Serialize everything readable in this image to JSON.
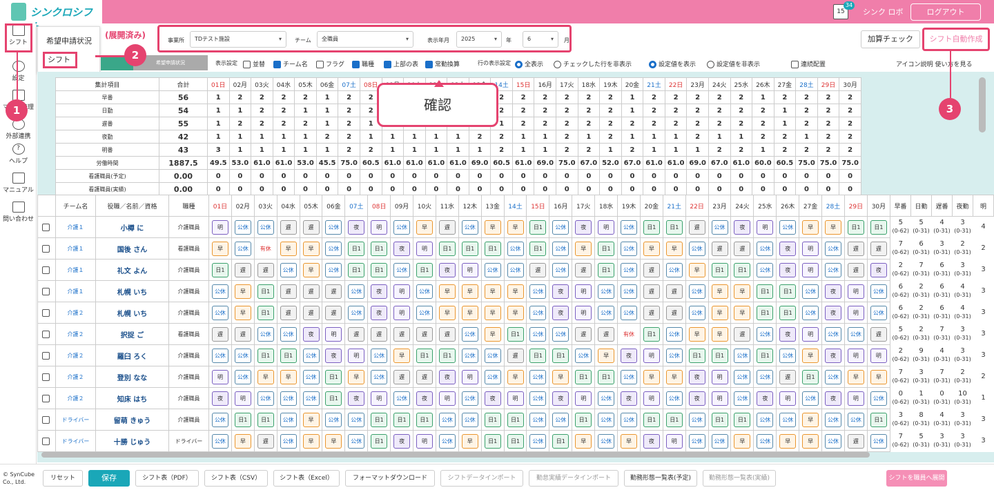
{
  "app": {
    "name": "シンクロシフト",
    "cal_day": "15",
    "notif": "34",
    "user": "シンク ロボ",
    "logout": "ログアウト"
  },
  "sidebar": [
    {
      "label": "シフト"
    },
    {
      "label": "設定"
    },
    {
      "label": "マスタ管理"
    },
    {
      "label": "外部連携"
    },
    {
      "label": "ヘルプ"
    },
    {
      "label": "マニュアル"
    },
    {
      "label": "問い合わせ"
    }
  ],
  "dropdown": {
    "item1": "希望申請状況",
    "item2": "シフト",
    "note": "(展開済み)"
  },
  "filters": {
    "office_label": "事業所",
    "office": "TDテスト施設",
    "team_label": "チーム",
    "team": "全職員",
    "ym_label": "表示年月",
    "year": "2025",
    "year_unit": "年",
    "month": "6",
    "month_unit": "月"
  },
  "buttons": {
    "calc": "加算チェック",
    "auto": "シフト自動作成"
  },
  "tabs": {
    "tab2": "希望申請状況"
  },
  "options": {
    "display": "表示設定",
    "sort": "並替",
    "team_name": "チーム名",
    "flag": "フラグ",
    "job": "職種",
    "top_table": "上部の表",
    "fte": "常勤換算",
    "row_setting": "行の表示設定",
    "all": "全表示",
    "hide_checked": "チェックした行を非表示",
    "show_value": "設定値を表示",
    "hide_value": "設定値を非表示",
    "serial": "連続配置",
    "icon_help": "アイコン説明",
    "howto": "使い方を見る"
  },
  "callout": "確認",
  "marks": [
    "1",
    "2",
    "3"
  ],
  "days": [
    "01日",
    "02月",
    "03火",
    "04水",
    "05木",
    "06金",
    "07土",
    "08日",
    "09月",
    "10火",
    "11水",
    "12木",
    "13金",
    "14土",
    "15日",
    "16月",
    "17火",
    "18水",
    "19木",
    "20金",
    "21土",
    "22日",
    "23月",
    "24火",
    "25水",
    "26木",
    "27金",
    "28土",
    "29日",
    "30月"
  ],
  "summary": {
    "header": "集計項目",
    "total": "合計",
    "rows": [
      {
        "label": "早番",
        "total": "56",
        "vals": [
          "1",
          "2",
          "2",
          "2",
          "2",
          "1",
          "2",
          "2",
          "",
          "",
          "",
          "",
          "",
          "2",
          "2",
          "2",
          "2",
          "2",
          "2",
          "1",
          "2",
          "2",
          "2",
          "2",
          "2",
          "1",
          "2",
          "2",
          "2",
          "2"
        ]
      },
      {
        "label": "日勤",
        "total": "54",
        "vals": [
          "1",
          "1",
          "2",
          "2",
          "1",
          "1",
          "2",
          "2",
          "",
          "",
          "",
          "",
          "",
          "2",
          "2",
          "2",
          "2",
          "2",
          "2",
          "1",
          "2",
          "2",
          "2",
          "2",
          "2",
          "2",
          "1",
          "2",
          "2",
          "2"
        ]
      },
      {
        "label": "遅番",
        "total": "55",
        "vals": [
          "1",
          "2",
          "2",
          "2",
          "2",
          "1",
          "2",
          "1",
          "",
          "",
          "",
          "",
          "",
          "1",
          "2",
          "2",
          "2",
          "2",
          "2",
          "2",
          "2",
          "2",
          "2",
          "2",
          "2",
          "2",
          "1",
          "2",
          "2",
          "2"
        ]
      },
      {
        "label": "夜勤",
        "total": "42",
        "vals": [
          "1",
          "1",
          "1",
          "1",
          "1",
          "2",
          "2",
          "1",
          "1",
          "1",
          "1",
          "1",
          "2",
          "2",
          "1",
          "1",
          "2",
          "1",
          "2",
          "1",
          "1",
          "1",
          "2",
          "1",
          "1",
          "2",
          "2",
          "1",
          "2",
          "2"
        ]
      },
      {
        "label": "明番",
        "total": "43",
        "vals": [
          "3",
          "1",
          "1",
          "1",
          "1",
          "1",
          "2",
          "2",
          "1",
          "1",
          "1",
          "1",
          "1",
          "2",
          "1",
          "1",
          "2",
          "2",
          "1",
          "2",
          "1",
          "1",
          "1",
          "2",
          "2",
          "1",
          "2",
          "2",
          "2",
          "2"
        ]
      },
      {
        "label": "労働時間",
        "total": "1887.5",
        "vals": [
          "49.5",
          "53.0",
          "61.0",
          "61.0",
          "53.0",
          "45.5",
          "75.0",
          "60.5",
          "61.0",
          "61.0",
          "61.0",
          "61.0",
          "69.0",
          "60.5",
          "61.0",
          "69.0",
          "75.0",
          "67.0",
          "52.0",
          "67.0",
          "61.0",
          "61.0",
          "69.0",
          "67.0",
          "61.0",
          "60.0",
          "60.5",
          "75.0",
          "75.0",
          "75.0"
        ]
      },
      {
        "label": "看護職員(予定)",
        "total": "0.00",
        "vals": [
          "0",
          "0",
          "0",
          "0",
          "0",
          "0",
          "0",
          "0",
          "0",
          "0",
          "0",
          "0",
          "0",
          "0",
          "0",
          "0",
          "0",
          "0",
          "0",
          "0",
          "0",
          "0",
          "0",
          "0",
          "0",
          "0",
          "0",
          "0",
          "0",
          "0"
        ]
      },
      {
        "label": "看護職員(実績)",
        "total": "0.00",
        "vals": [
          "0",
          "0",
          "0",
          "0",
          "0",
          "0",
          "0",
          "0",
          "0",
          "0",
          "0",
          "0",
          "0",
          "0",
          "0",
          "0",
          "0",
          "0",
          "0",
          "0",
          "0",
          "0",
          "0",
          "0",
          "0",
          "0",
          "0",
          "0",
          "0",
          "0"
        ]
      }
    ]
  },
  "staff": {
    "team_h": "チーム名",
    "role_h": "役職／名前／資格",
    "job_h": "職種",
    "cols": [
      "早番",
      "日勤",
      "遅番",
      "夜勤",
      "明"
    ],
    "rows": [
      {
        "team": "介護１",
        "name": "小樽 に",
        "job": "介護職員",
        "shifts": [
          "明",
          "公休",
          "公休",
          "遅",
          "遅",
          "公休",
          "夜",
          "明",
          "公休",
          "早",
          "遅",
          "公休",
          "早",
          "早",
          "日1",
          "公休",
          "夜",
          "明",
          "公休",
          "日1",
          "日1",
          "遅",
          "公休",
          "夜",
          "明",
          "公休",
          "早",
          "早",
          "日1",
          "日1"
        ],
        "stats": [
          [
            "5",
            "(0-62)"
          ],
          [
            "5",
            "(0-31)"
          ],
          [
            "4",
            "(0-31)"
          ],
          [
            "3",
            "(0-31)"
          ],
          [
            "4",
            ""
          ]
        ]
      },
      {
        "team": "介護１",
        "name": "国後 さん",
        "job": "看護職員",
        "shifts": [
          "早",
          "公休",
          "有休",
          "早",
          "早",
          "公休",
          "日1",
          "日1",
          "夜",
          "明",
          "日1",
          "日1",
          "日1",
          "公休",
          "日1",
          "公休",
          "早",
          "日1",
          "公休",
          "早",
          "早",
          "公休",
          "遅",
          "遅",
          "公休",
          "夜",
          "明",
          "公休",
          "遅",
          "遅"
        ],
        "stats": [
          [
            "7",
            "(0-62)"
          ],
          [
            "6",
            "(0-31)"
          ],
          [
            "3",
            "(0-31)"
          ],
          [
            "2",
            "(0-31)"
          ],
          [
            "2",
            ""
          ]
        ]
      },
      {
        "team": "介護１",
        "name": "礼文 よん",
        "job": "介護職員",
        "shifts": [
          "日1",
          "遅",
          "遅",
          "公休",
          "早",
          "公休",
          "日1",
          "日1",
          "公休",
          "日1",
          "夜",
          "明",
          "公休",
          "公休",
          "遅",
          "公休",
          "遅",
          "日1",
          "公休",
          "遅",
          "公休",
          "早",
          "日1",
          "日1",
          "公休",
          "夜",
          "明",
          "公休",
          "遅",
          "夜"
        ],
        "stats": [
          [
            "2",
            "(0-62)"
          ],
          [
            "7",
            "(0-31)"
          ],
          [
            "6",
            "(0-31)"
          ],
          [
            "3",
            "(0-31)"
          ],
          [
            "3",
            ""
          ]
        ]
      },
      {
        "team": "介護１",
        "name": "札幌 いち",
        "job": "介護職員",
        "shifts": [
          "公休",
          "早",
          "日1",
          "遅",
          "遅",
          "遅",
          "公休",
          "夜",
          "明",
          "公休",
          "早",
          "早",
          "早",
          "早",
          "公休",
          "夜",
          "明",
          "公休",
          "公休",
          "遅",
          "遅",
          "公休",
          "早",
          "早",
          "日1",
          "日1",
          "公休",
          "夜",
          "明",
          "公休"
        ],
        "stats": [
          [
            "6",
            "(0-62)"
          ],
          [
            "2",
            "(0-31)"
          ],
          [
            "6",
            "(0-31)"
          ],
          [
            "4",
            "(0-31)"
          ],
          [
            "3",
            ""
          ]
        ]
      },
      {
        "team": "介護２",
        "name": "札幌 いち",
        "job": "介護職員",
        "shifts": [
          "公休",
          "早",
          "日1",
          "遅",
          "遅",
          "遅",
          "公休",
          "夜",
          "明",
          "公休",
          "早",
          "早",
          "早",
          "早",
          "公休",
          "夜",
          "明",
          "公休",
          "公休",
          "遅",
          "遅",
          "公休",
          "早",
          "早",
          "日1",
          "日1",
          "公休",
          "夜",
          "明",
          "公休"
        ],
        "stats": [
          [
            "6",
            "(0-62)"
          ],
          [
            "2",
            "(0-31)"
          ],
          [
            "6",
            "(0-31)"
          ],
          [
            "4",
            "(0-31)"
          ],
          [
            "3",
            ""
          ]
        ]
      },
      {
        "team": "介護２",
        "name": "択捉 ご",
        "job": "看護職員",
        "shifts": [
          "遅",
          "遅",
          "公休",
          "公休",
          "夜",
          "明",
          "遅",
          "遅",
          "遅",
          "遅",
          "遅",
          "公休",
          "早",
          "日1",
          "公休",
          "公休",
          "遅",
          "遅",
          "有休",
          "日1",
          "公休",
          "早",
          "早",
          "遅",
          "公休",
          "夜",
          "明",
          "公休",
          "公休",
          "遅"
        ],
        "stats": [
          [
            "5",
            "(0-62)"
          ],
          [
            "2",
            "(0-31)"
          ],
          [
            "7",
            "(0-31)"
          ],
          [
            "3",
            "(0-31)"
          ],
          [
            "3",
            ""
          ]
        ]
      },
      {
        "team": "介護２",
        "name": "羅臼 ろく",
        "job": "介護職員",
        "shifts": [
          "公休",
          "公休",
          "日1",
          "日1",
          "公休",
          "夜",
          "明",
          "公休",
          "早",
          "日1",
          "日1",
          "公休",
          "公休",
          "遅",
          "日1",
          "日1",
          "公休",
          "早",
          "夜",
          "明",
          "公休",
          "日1",
          "日1",
          "公休",
          "日1",
          "公休",
          "早",
          "夜",
          "明",
          "明"
        ],
        "stats": [
          [
            "2",
            "(0-62)"
          ],
          [
            "9",
            "(0-31)"
          ],
          [
            "4",
            "(0-31)"
          ],
          [
            "3",
            "(0-31)"
          ],
          [
            "3",
            ""
          ]
        ]
      },
      {
        "team": "介護２",
        "name": "登別 なな",
        "job": "介護職員",
        "shifts": [
          "明",
          "公休",
          "早",
          "早",
          "公休",
          "日1",
          "早",
          "公休",
          "遅",
          "遅",
          "夜",
          "明",
          "公休",
          "早",
          "公休",
          "早",
          "日1",
          "日1",
          "公休",
          "早",
          "早",
          "夜",
          "明",
          "公休",
          "公休",
          "遅",
          "日1",
          "公休",
          "早",
          "早"
        ],
        "stats": [
          [
            "7",
            "(0-62)"
          ],
          [
            "3",
            "(0-31)"
          ],
          [
            "7",
            "(0-31)"
          ],
          [
            "2",
            "(0-31)"
          ],
          [
            "2",
            ""
          ]
        ]
      },
      {
        "team": "介護２",
        "name": "知床 はち",
        "job": "介護職員",
        "shifts": [
          "夜",
          "明",
          "公休",
          "公休",
          "公休",
          "日1",
          "夜",
          "明",
          "公休",
          "夜",
          "明",
          "公休",
          "夜",
          "明",
          "公休",
          "夜",
          "明",
          "公休",
          "夜",
          "明",
          "公休",
          "夜",
          "明",
          "公休",
          "夜",
          "明",
          "公休",
          "夜",
          "明",
          "公休"
        ],
        "stats": [
          [
            "0",
            "(0-62)"
          ],
          [
            "1",
            "(0-31)"
          ],
          [
            "0",
            "(0-31)"
          ],
          [
            "10",
            "(0-31)"
          ],
          [
            "1",
            ""
          ]
        ]
      },
      {
        "team": "ドライバー",
        "name": "留萌 きゅう",
        "job": "介護職員",
        "shifts": [
          "公休",
          "日1",
          "日1",
          "公休",
          "早",
          "公休",
          "公休",
          "日1",
          "日1",
          "日1",
          "公休",
          "公休",
          "日1",
          "日1",
          "公休",
          "公休",
          "日1",
          "公休",
          "公休",
          "日1",
          "日1",
          "公休",
          "日1",
          "日1",
          "公休",
          "公休",
          "早",
          "公休",
          "公休",
          "日1"
        ],
        "stats": [
          [
            "3",
            "(0-62)"
          ],
          [
            "8",
            "(0-31)"
          ],
          [
            "4",
            "(0-31)"
          ],
          [
            "3",
            "(0-31)"
          ],
          [
            "3",
            ""
          ]
        ]
      },
      {
        "team": "ドライバー",
        "name": "十勝 じゅう",
        "job": "ドライバー",
        "shifts": [
          "公休",
          "早",
          "遅",
          "公休",
          "早",
          "早",
          "公休",
          "日1",
          "夜",
          "明",
          "公休",
          "早",
          "日1",
          "日1",
          "公休",
          "日1",
          "早",
          "公休",
          "早",
          "夜",
          "明",
          "公休",
          "公休",
          "早",
          "公休",
          "早",
          "早",
          "公休",
          "遅",
          "公休"
        ],
        "stats": [
          [
            "7",
            "(0-62)"
          ],
          [
            "5",
            "(0-31)"
          ],
          [
            "3",
            "(0-31)"
          ],
          [
            "3",
            "(0-31)"
          ],
          [
            "3",
            ""
          ]
        ]
      }
    ]
  },
  "footer": {
    "reset": "リセット",
    "save": "保存",
    "pdf": "シフト表（PDF）",
    "csv": "シフト表（CSV）",
    "excel": "シフト表（Excel）",
    "format": "フォーマットダウンロード",
    "import": "シフトデータインポート",
    "actual": "勤怠実績データインポート",
    "plan": "勤務形態一覧表(予定)",
    "result": "勤務形態一覧表(実績)",
    "deploy": "シフトを職員へ展開",
    "copyright": "© SynCube Co., Ltd."
  }
}
